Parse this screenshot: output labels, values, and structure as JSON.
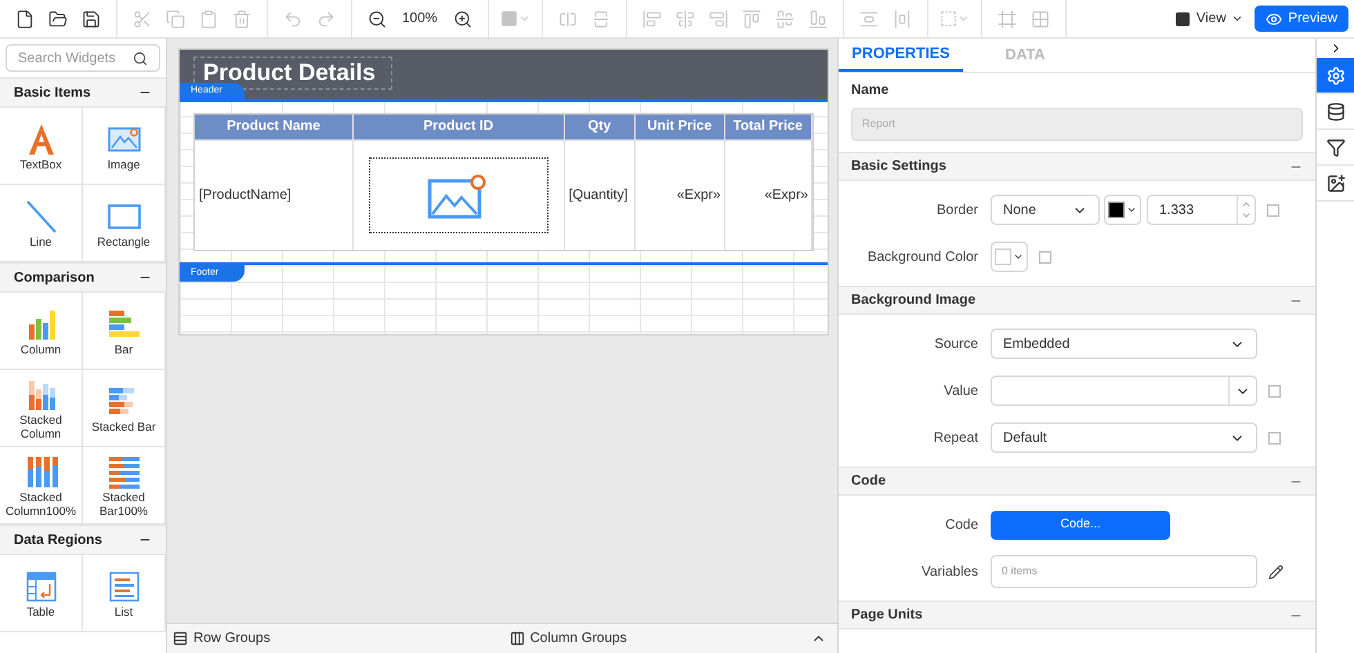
{
  "toolbar": {
    "groups": [
      {
        "items": [
          {
            "kind": "icon",
            "disabled": false
          },
          {
            "kind": "icon",
            "disabled": false
          },
          {
            "kind": "icon",
            "disabled": false
          }
        ]
      },
      {
        "items": [
          {
            "kind": "icon",
            "disabled": true
          },
          {
            "kind": "icon",
            "disabled": true
          },
          {
            "kind": "icon",
            "disabled": true
          },
          {
            "kind": "icon",
            "disabled": true
          }
        ]
      },
      {
        "items": [
          {
            "kind": "icon",
            "disabled": true
          },
          {
            "kind": "icon",
            "disabled": true
          }
        ]
      },
      {
        "items": [
          {
            "kind": "icon",
            "disabled": false
          },
          {
            "kind": "text",
            "label": "100%"
          },
          {
            "kind": "icon",
            "disabled": false
          }
        ]
      },
      {
        "items": [
          {
            "kind": "dropdown",
            "disabled": true
          }
        ]
      },
      {
        "items": [
          {
            "kind": "icon",
            "disabled": true
          },
          {
            "kind": "icon",
            "disabled": true
          }
        ]
      },
      {
        "items": [
          {
            "kind": "icon",
            "disabled": true
          },
          {
            "kind": "icon",
            "disabled": true
          },
          {
            "kind": "icon",
            "disabled": true
          },
          {
            "kind": "icon",
            "disabled": true
          },
          {
            "kind": "icon",
            "disabled": true
          },
          {
            "kind": "icon",
            "disabled": true
          }
        ]
      },
      {
        "items": [
          {
            "kind": "icon",
            "disabled": true
          },
          {
            "kind": "icon",
            "disabled": true
          }
        ]
      },
      {
        "items": [
          {
            "kind": "dropdown",
            "disabled": true
          }
        ]
      },
      {
        "items": [
          {
            "kind": "icon",
            "disabled": true
          },
          {
            "kind": "icon",
            "disabled": true
          }
        ]
      }
    ],
    "view": "View",
    "preview": "Preview"
  },
  "widgets": {
    "search": {
      "placeholder": "Search Widgets"
    },
    "sections": [
      {
        "title": "Basic Items",
        "expanded": true,
        "items": [
          {
            "kind": "textbox",
            "label": "TextBox"
          },
          {
            "kind": "image",
            "label": "Image"
          },
          {
            "kind": "line",
            "label": "Line"
          },
          {
            "kind": "rectangle",
            "label": "Rectangle"
          }
        ]
      },
      {
        "title": "Comparison",
        "expanded": true,
        "items": [
          {
            "kind": "column",
            "label": "Column"
          },
          {
            "kind": "bar",
            "label": "Bar"
          },
          {
            "kind": "stacked-column",
            "label": "Stacked Column"
          },
          {
            "kind": "stacked-bar",
            "label": "Stacked Bar"
          },
          {
            "kind": "stacked-column100",
            "label": "Stacked Column100%"
          },
          {
            "kind": "stacked-bar100",
            "label": "Stacked Bar100%"
          }
        ]
      },
      {
        "title": "Data Regions",
        "expanded": true,
        "items": [
          {
            "kind": "table",
            "label": "Table"
          },
          {
            "kind": "list",
            "label": "List"
          }
        ]
      }
    ]
  },
  "report": {
    "title": "Product Details",
    "header_label": "Header",
    "footer_label": "Footer",
    "table": {
      "columns": [
        "Product Name",
        "Product ID",
        "Qty",
        "Unit Price",
        "Total Price"
      ],
      "cells": [
        {
          "kind": "text",
          "text": "[ProductName]"
        },
        {
          "kind": "image"
        },
        {
          "kind": "text",
          "text": "[Quantity]"
        },
        {
          "kind": "expr",
          "text": "«Expr»"
        },
        {
          "kind": "expr",
          "text": "«Expr»"
        }
      ]
    }
  },
  "groups_bar": {
    "row_groups": "Row Groups",
    "column_groups": "Column Groups"
  },
  "properties": {
    "tabs": [
      {
        "label": "PROPERTIES",
        "selected": true
      },
      {
        "label": "DATA",
        "selected": false
      }
    ],
    "name_label": "Name",
    "name_field": {
      "placeholder": "Report",
      "disabled": true
    },
    "sections": [
      {
        "title": "Basic Settings",
        "expanded": true,
        "rows": [
          {
            "kind": "border",
            "label": "Border",
            "value": "None",
            "color": "#000000",
            "number": "1.333",
            "checked": false
          },
          {
            "kind": "color",
            "label": "Background Color",
            "color": "#ffffff",
            "checked": false
          }
        ]
      },
      {
        "title": "Background Image",
        "expanded": true,
        "rows": [
          {
            "kind": "select",
            "label": "Source",
            "value": "Embedded"
          },
          {
            "kind": "combo",
            "label": "Value",
            "checked": false
          },
          {
            "kind": "select",
            "label": "Repeat",
            "value": "Default",
            "checked": false
          }
        ]
      },
      {
        "title": "Code",
        "expanded": true,
        "rows": [
          {
            "kind": "button",
            "label": "Code",
            "value": "Code..."
          },
          {
            "kind": "list",
            "label": "Variables",
            "placeholder": "0 items"
          }
        ]
      },
      {
        "title": "Page Units",
        "expanded": true
      }
    ]
  },
  "side_strip": {
    "items": [
      {
        "selected": true
      },
      {
        "selected": false
      },
      {
        "selected": false
      },
      {
        "selected": false
      }
    ]
  }
}
